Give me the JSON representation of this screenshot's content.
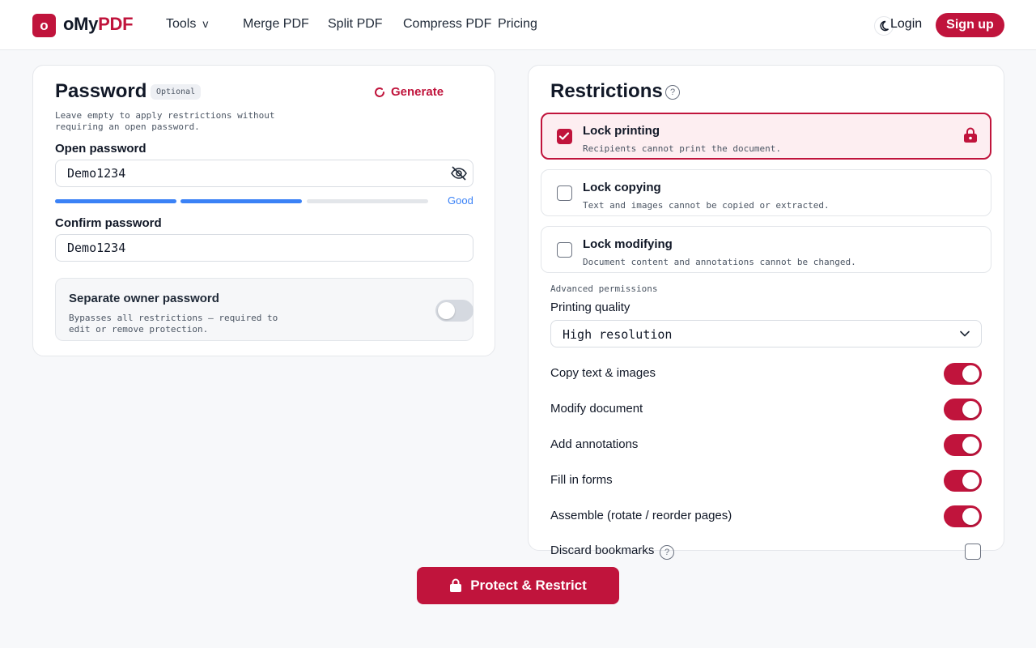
{
  "header": {
    "logo_letter": "o",
    "logo_text_main": "oMy",
    "logo_text_accent": "PDF",
    "nav": {
      "tools": "Tools",
      "tools_caret": "v",
      "merge": "Merge PDF",
      "split": "Split PDF",
      "compress": "Compress PDF",
      "pricing": "Pricing"
    },
    "login": "Login",
    "signup": "Sign up"
  },
  "password_panel": {
    "title": "Password",
    "optional_badge": "Optional",
    "generate_label": "Generate",
    "hint": "Leave empty to apply restrictions without requiring an open password.",
    "open_password_label": "Open password",
    "open_password_value": "Demo1234",
    "strength_label": "Good",
    "strength_level": 2,
    "strength_max": 3,
    "confirm_password_label": "Confirm password",
    "confirm_password_value": "Demo1234",
    "owner": {
      "title": "Separate owner password",
      "description": "Bypasses all restrictions — required to edit or remove protection.",
      "enabled": false
    }
  },
  "restrictions_panel": {
    "title": "Restrictions",
    "help": "?",
    "items": [
      {
        "title": "Lock printing",
        "description": "Recipients cannot print the document.",
        "checked": true
      },
      {
        "title": "Lock copying",
        "description": "Text and images cannot be copied or extracted.",
        "checked": false
      },
      {
        "title": "Lock modifying",
        "description": "Document content and annotations cannot be changed.",
        "checked": false
      }
    ],
    "advanced_label": "Advanced permissions",
    "printing_quality_label": "Printing quality",
    "printing_quality_value": "High resolution",
    "permissions": [
      {
        "label": "Copy text & images",
        "enabled": true
      },
      {
        "label": "Modify document",
        "enabled": true
      },
      {
        "label": "Add annotations",
        "enabled": true
      },
      {
        "label": "Fill in forms",
        "enabled": true
      },
      {
        "label": "Assemble (rotate / reorder pages)",
        "enabled": true
      }
    ],
    "discard_bookmarks_label": "Discard bookmarks",
    "discard_bookmarks_checked": false
  },
  "protect_button": "Protect & Restrict",
  "colors": {
    "accent": "#c0143c",
    "strength_blue": "#3b82f6"
  }
}
